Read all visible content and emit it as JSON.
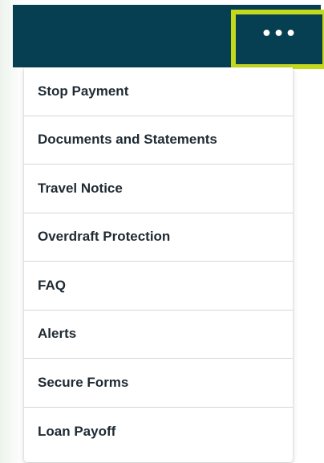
{
  "header": {
    "more_button": {
      "label": "•••",
      "icon": "more-horizontal-icon"
    }
  },
  "menu": {
    "items": [
      {
        "label": "Stop Payment"
      },
      {
        "label": "Documents and Statements"
      },
      {
        "label": "Travel Notice"
      },
      {
        "label": "Overdraft Protection"
      },
      {
        "label": "FAQ"
      },
      {
        "label": "Alerts"
      },
      {
        "label": "Secure Forms"
      },
      {
        "label": "Loan Payoff"
      }
    ]
  },
  "colors": {
    "header_bg": "#063e52",
    "highlight_border": "#c5d91c",
    "menu_text": "#1f2a33",
    "divider": "#d7d7d7"
  }
}
